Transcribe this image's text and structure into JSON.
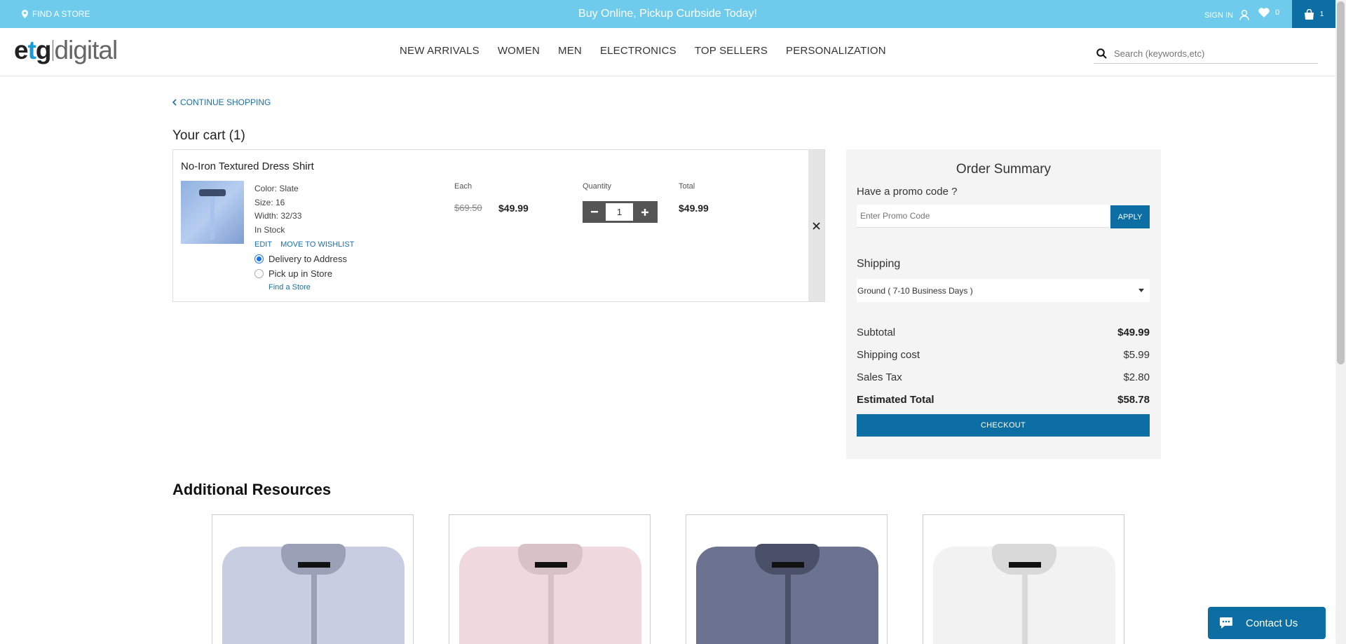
{
  "topbar": {
    "find_store": "FIND A STORE",
    "promo": "Buy Online, Pickup Curbside Today!",
    "sign_in": "SIGN IN",
    "wishlist_count": "0",
    "cart_count": "1"
  },
  "header": {
    "logo_main": "etg",
    "logo_sub": "digital",
    "nav": [
      "NEW ARRIVALS",
      "WOMEN",
      "MEN",
      "ELECTRONICS",
      "TOP SELLERS",
      "PERSONALIZATION"
    ],
    "search_placeholder": "Search (keywords,etc)"
  },
  "cart": {
    "continue": "CONTINUE SHOPPING",
    "title": "Your cart (1)",
    "item": {
      "name": "No-Iron Textured Dress Shirt",
      "color": "Color: Slate",
      "size": "Size: 16",
      "width": "Width: 32/33",
      "stock": "In Stock",
      "edit": "EDIT",
      "move_wishlist": "MOVE TO WISHLIST",
      "delivery": "Delivery to Address",
      "pickup": "Pick up in Store",
      "find_store": "Find a Store",
      "each_label": "Each",
      "old_price": "$69.50",
      "price": "$49.99",
      "qty_label": "Quantity",
      "qty": "1",
      "total_label": "Total",
      "total": "$49.99"
    }
  },
  "summary": {
    "title": "Order Summary",
    "promo_question": "Have a promo code ?",
    "promo_placeholder": "Enter Promo Code",
    "apply": "APPLY",
    "shipping_label": "Shipping",
    "shipping_option": "Ground ( 7-10 Business Days )",
    "subtotal_label": "Subtotal",
    "subtotal": "$49.99",
    "shipping_cost_label": "Shipping cost",
    "shipping_cost": "$5.99",
    "tax_label": "Sales Tax",
    "tax": "$2.80",
    "estimated_label": "Estimated Total",
    "estimated": "$58.78",
    "checkout": "CHECKOUT"
  },
  "additional": {
    "title": "Additional Resources",
    "products": [
      {
        "color": "#c8cde2",
        "collar": "#9aa0b6"
      },
      {
        "color": "#efd9df",
        "collar": "#d9c1c8"
      },
      {
        "color": "#6c7391",
        "collar": "#4a5068"
      },
      {
        "color": "#f2f2f2",
        "collar": "#d9d9d9"
      }
    ]
  },
  "contact": {
    "label": "Contact Us"
  },
  "colors": {
    "topbar": "#6ecbec",
    "accent": "#0d6ea3",
    "link": "#1a6fa8"
  }
}
